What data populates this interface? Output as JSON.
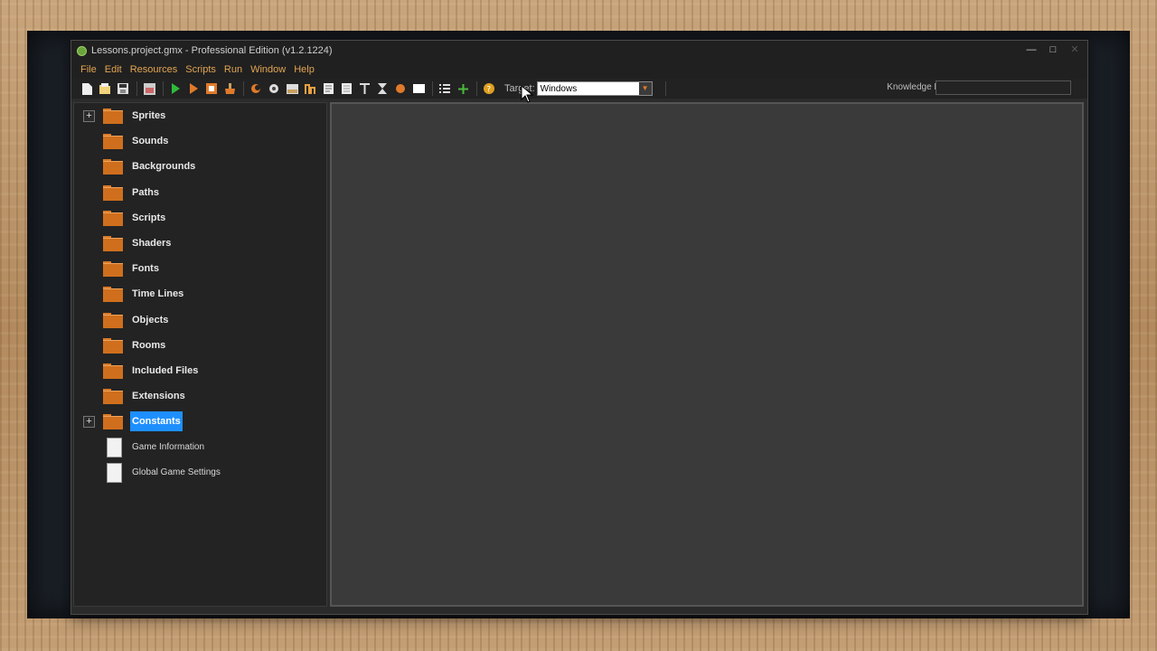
{
  "window": {
    "title": "Lessons.project.gmx  -  Professional Edition (v1.2.1224)",
    "controls": [
      "minimize",
      "maximize",
      "close"
    ]
  },
  "menu": [
    {
      "label": "File"
    },
    {
      "label": "Edit"
    },
    {
      "label": "Resources"
    },
    {
      "label": "Scripts"
    },
    {
      "label": "Run"
    },
    {
      "label": "Window"
    },
    {
      "label": "Help"
    }
  ],
  "toolbar": {
    "icons": [
      "new-project-icon",
      "open-project-icon",
      "save-project-icon",
      "create-executable-icon",
      "run-icon",
      "debug-icon",
      "stop-icon",
      "clean-icon",
      "sprite-icon",
      "sound-icon",
      "background-icon",
      "path-icon",
      "script-icon",
      "shader-icon",
      "font-icon",
      "timeline-icon",
      "object-icon",
      "room-icon",
      "game-information-icon",
      "global-settings-icon",
      "help-icon"
    ],
    "target_label": "Target:",
    "target_value": "Windows",
    "knowledge_base_label": "Knowledge Base:"
  },
  "tree": {
    "items": [
      {
        "label": "Sprites",
        "type": "folder",
        "expandable": true
      },
      {
        "label": "Sounds",
        "type": "folder",
        "expandable": false
      },
      {
        "label": "Backgrounds",
        "type": "folder",
        "expandable": false
      },
      {
        "label": "Paths",
        "type": "folder",
        "expandable": false
      },
      {
        "label": "Scripts",
        "type": "folder",
        "expandable": false
      },
      {
        "label": "Shaders",
        "type": "folder",
        "expandable": false
      },
      {
        "label": "Fonts",
        "type": "folder",
        "expandable": false
      },
      {
        "label": "Time Lines",
        "type": "folder",
        "expandable": false
      },
      {
        "label": "Objects",
        "type": "folder",
        "expandable": false
      },
      {
        "label": "Rooms",
        "type": "folder",
        "expandable": false
      },
      {
        "label": "Included Files",
        "type": "folder",
        "expandable": false
      },
      {
        "label": "Extensions",
        "type": "folder",
        "expandable": false
      },
      {
        "label": "Constants",
        "type": "folder",
        "expandable": true,
        "selected": true
      },
      {
        "label": "Game Information",
        "type": "document"
      },
      {
        "label": "Global Game Settings",
        "type": "document"
      }
    ]
  },
  "colors": {
    "accent_menu": "#e3a552",
    "folder": "#cf6f1d",
    "selection": "#1e8fff",
    "panel_bg": "#232323",
    "main_bg": "#3a3a3a"
  }
}
